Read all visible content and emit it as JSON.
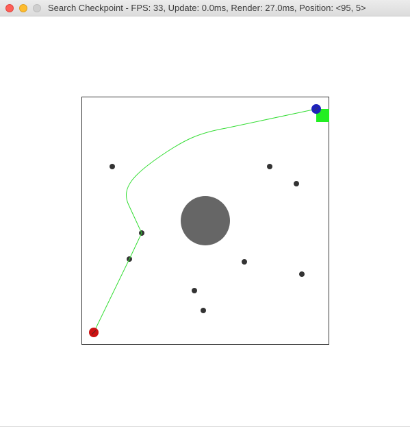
{
  "window": {
    "title": "Search Checkpoint  -  FPS: 33, Update: 0.0ms, Render: 27.0ms, Position: <95, 5>"
  },
  "scene": {
    "colors": {
      "boundary": "#333333",
      "path": "#33dd33",
      "start": "#cc1111",
      "goal_marker": "#1e22bb",
      "goal_square": "#22ee22",
      "obstacle": "#666666",
      "waypoint": "#333333"
    }
  }
}
